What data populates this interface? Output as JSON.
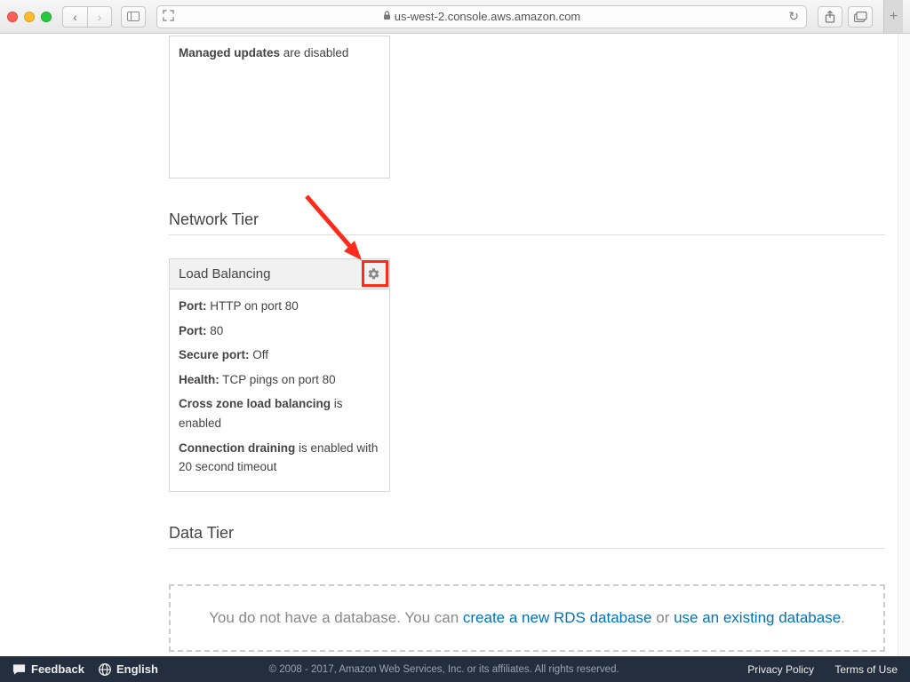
{
  "browser": {
    "url": "us-west-2.console.aws.amazon.com"
  },
  "managed_updates": {
    "label": "Managed updates",
    "status": "are disabled"
  },
  "network_tier": {
    "heading": "Network Tier",
    "load_balancing": {
      "title": "Load Balancing",
      "port1_label": "Port:",
      "port1_value": "HTTP on port 80",
      "port2_label": "Port:",
      "port2_value": "80",
      "secure_label": "Secure port:",
      "secure_value": "Off",
      "health_label": "Health:",
      "health_value": "TCP pings on port 80",
      "czlb_label": "Cross zone load balancing",
      "czlb_value": "is enabled",
      "drain_label": "Connection draining",
      "drain_value": "is enabled with 20 second timeout"
    }
  },
  "data_tier": {
    "heading": "Data Tier",
    "prefix": "You do not have a database. You can ",
    "link1": "create a new RDS database",
    "mid": " or ",
    "link2": "use an existing database",
    "suffix": "."
  },
  "footer": {
    "feedback": "Feedback",
    "language": "English",
    "copyright": "© 2008 - 2017, Amazon Web Services, Inc. or its affiliates. All rights reserved.",
    "privacy": "Privacy Policy",
    "terms": "Terms of Use"
  }
}
